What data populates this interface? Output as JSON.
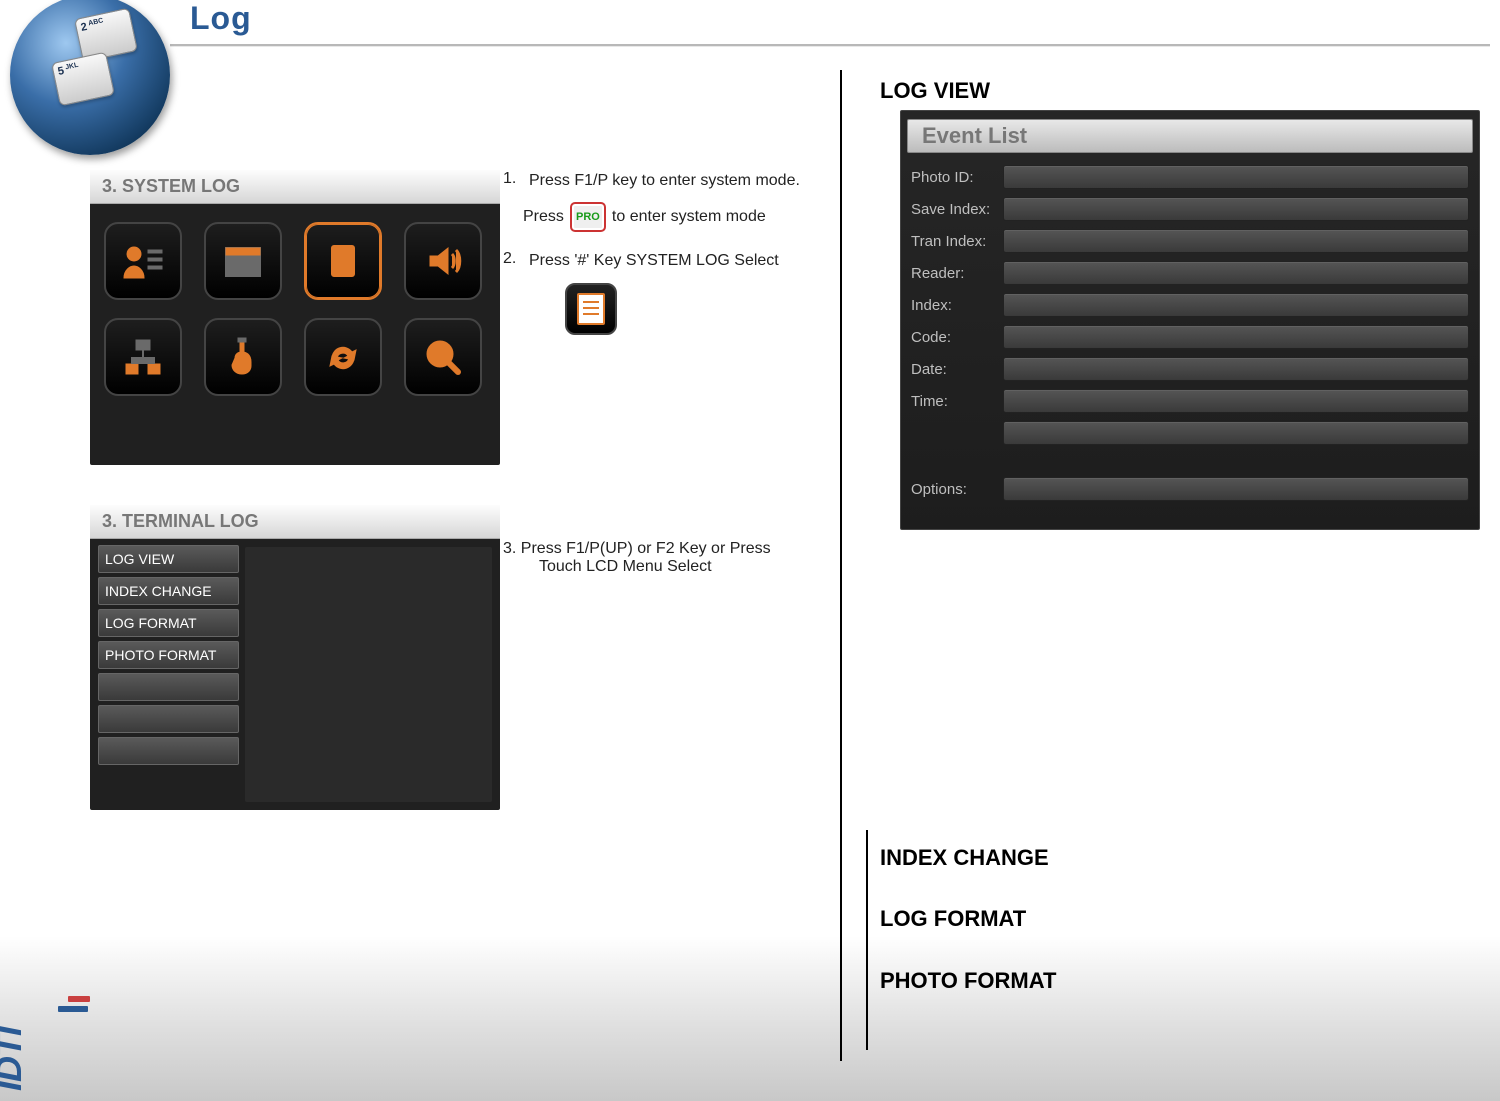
{
  "title": "Log",
  "ball_keys": {
    "k1": "2",
    "k1_sub": "ABC",
    "k2": "5",
    "k2_sub": "JKL"
  },
  "logo": "IDTI",
  "syslog_panel": {
    "header": "3. SYSTEM LOG"
  },
  "termlog_panel": {
    "header": "3. TERMINAL LOG",
    "menu": [
      "LOG VIEW",
      "INDEX CHANGE",
      "LOG FORMAT",
      "PHOTO FORMAT"
    ]
  },
  "instructions": {
    "step1_num": "1.",
    "step1": "Press F1/P key to enter system mode.",
    "step1b_pre": "Press",
    "step1b_badge": "PRO",
    "step1b_post": "to enter system mode",
    "step2_num": "2.",
    "step2": "Press '#' Key SYSTEM LOG Select",
    "step3_line1": "3. Press  F1/P(UP) or F2 Key or  Press",
    "step3_line2": "Touch LCD Menu Select"
  },
  "right": {
    "log_view": "LOG VIEW",
    "index_change": "INDEX CHANGE",
    "log_format": "LOG FORMAT",
    "photo_format": "PHOTO FORMAT"
  },
  "event_list": {
    "title": "Event List",
    "rows": [
      {
        "label": "Photo ID:"
      },
      {
        "label": "Save Index:"
      },
      {
        "label": "Tran Index:"
      },
      {
        "label": "Reader:"
      },
      {
        "label": "Index:"
      },
      {
        "label": "Code:"
      },
      {
        "label": "Date:"
      },
      {
        "label": "Time:"
      }
    ],
    "extra_row_label": "",
    "options_label": "Options:"
  }
}
